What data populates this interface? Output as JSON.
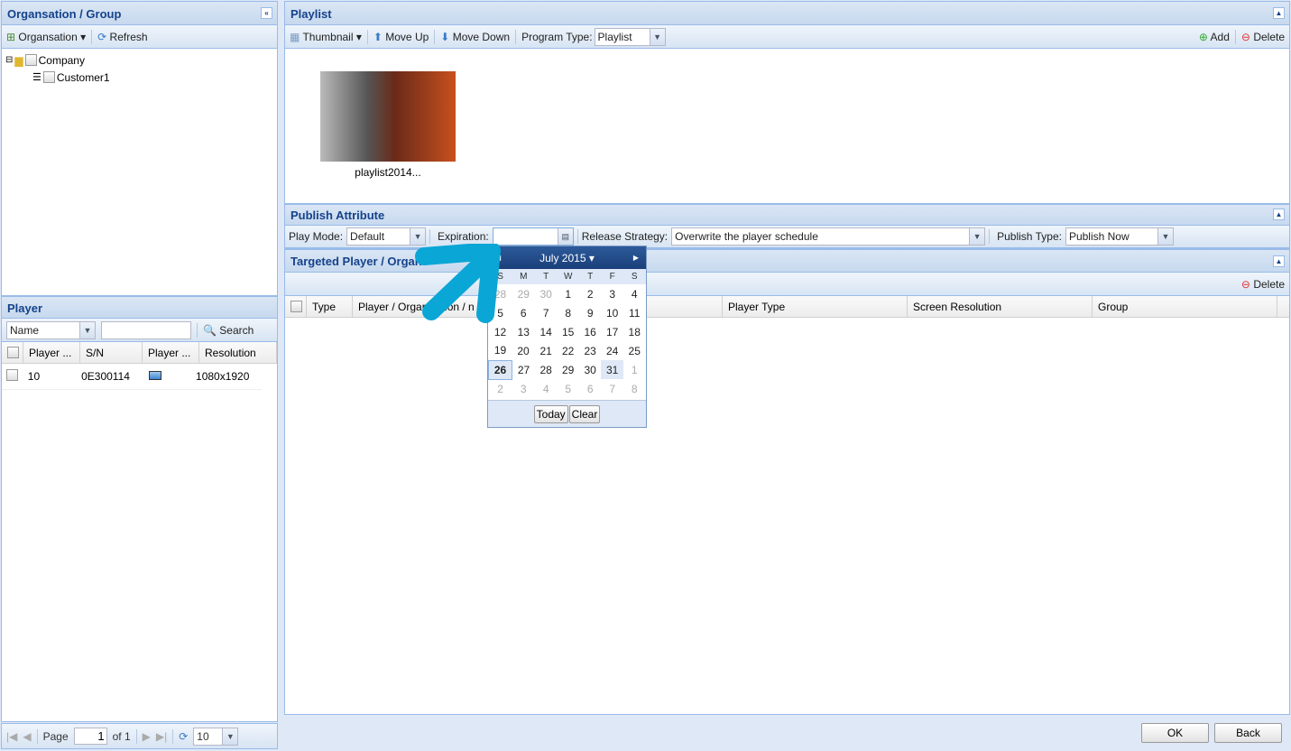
{
  "left": {
    "title": "Organsation / Group",
    "toolbar": {
      "org": "Organsation",
      "refresh": "Refresh"
    },
    "tree": [
      {
        "label": "Company"
      },
      {
        "label": "Customer1"
      }
    ]
  },
  "player": {
    "title": "Player",
    "filter": "Name",
    "search_value": "",
    "search": "Search",
    "columns": [
      "Player ...",
      "S/N",
      "Player ...",
      "Resolution"
    ],
    "rows": [
      {
        "name": "10",
        "sn": "0E300114",
        "type_icon": "monitor-icon",
        "resolution": "1080x1920"
      }
    ],
    "pager": {
      "page_label": "Page",
      "page": "1",
      "of": "of 1",
      "size": "10"
    }
  },
  "playlist": {
    "title": "Playlist",
    "toolbar": {
      "thumbnail": "Thumbnail",
      "move_up": "Move Up",
      "move_down": "Move Down",
      "program_type_label": "Program Type:",
      "program_type": "Playlist",
      "add": "Add",
      "delete": "Delete"
    },
    "items": [
      {
        "label": "playlist2014..."
      }
    ]
  },
  "publish": {
    "title": "Publish Attribute",
    "play_mode_label": "Play Mode:",
    "play_mode": "Default",
    "expiration_label": "Expiration:",
    "expiration": "",
    "release_label": "Release Strategy:",
    "release": "Overwrite the player schedule",
    "publish_type_label": "Publish Type:",
    "publish_type": "Publish Now"
  },
  "targeted": {
    "title": "Targeted Player / Organ",
    "delete": "Delete",
    "columns": [
      "Type",
      "Player / Organisation / n",
      "Player Type",
      "Screen Resolution",
      "Group"
    ]
  },
  "calendar": {
    "month": "July 2015",
    "days": [
      "S",
      "M",
      "T",
      "W",
      "T",
      "F",
      "S"
    ],
    "weeks": [
      [
        "28",
        "29",
        "30",
        "1",
        "2",
        "3",
        "4"
      ],
      [
        "5",
        "6",
        "7",
        "8",
        "9",
        "10",
        "11"
      ],
      [
        "12",
        "13",
        "14",
        "15",
        "16",
        "17",
        "18"
      ],
      [
        "19",
        "20",
        "21",
        "22",
        "23",
        "24",
        "25"
      ],
      [
        "26",
        "27",
        "28",
        "29",
        "30",
        "31",
        "1"
      ],
      [
        "2",
        "3",
        "4",
        "5",
        "6",
        "7",
        "8"
      ]
    ],
    "selected": "26",
    "highlighted": "31",
    "today": "Today",
    "clear": "Clear"
  },
  "footer": {
    "ok": "OK",
    "back": "Back"
  },
  "colors": {
    "header_text": "#15428b",
    "border": "#99bbe8",
    "annotation_arrow": "#0aa6d6"
  }
}
